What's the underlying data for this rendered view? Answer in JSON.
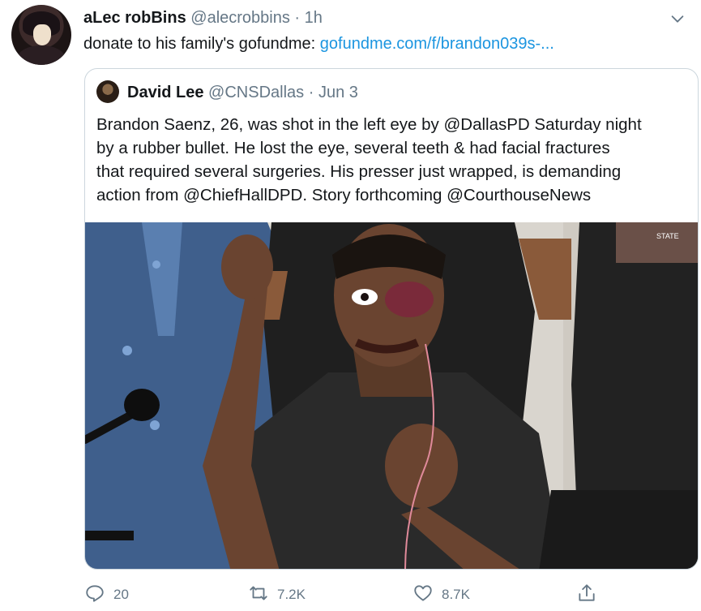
{
  "tweet": {
    "display_name": "aLec robBins",
    "handle": "@alecrobbins",
    "separator": "·",
    "time": "1h",
    "text_prefix": "donate to his family's gofundme: ",
    "link_text": "gofundme.com/f/brandon039s-..."
  },
  "quoted": {
    "display_name": "David Lee",
    "handle": "@CNSDallas",
    "separator": "·",
    "date": "Jun 3",
    "lines": [
      "Brandon Saenz, 26, was shot in the left eye by @DallasPD Saturday night",
      "by a rubber bullet. He lost the eye, several teeth & had facial fractures",
      "that required several surgeries. His presser just wrapped, is demanding",
      "action from @ChiefHallDPD. Story forthcoming @CourthouseNews"
    ],
    "photo_sign_text": "STATE"
  },
  "actions": {
    "reply_count": "20",
    "retweet_count": "7.2K",
    "like_count": "8.7K"
  },
  "colors": {
    "link": "#1b95e0",
    "muted": "#657786",
    "border": "#ccd6dd"
  },
  "icons": [
    "caret-down-icon",
    "reply-icon",
    "retweet-icon",
    "like-icon",
    "share-icon"
  ]
}
